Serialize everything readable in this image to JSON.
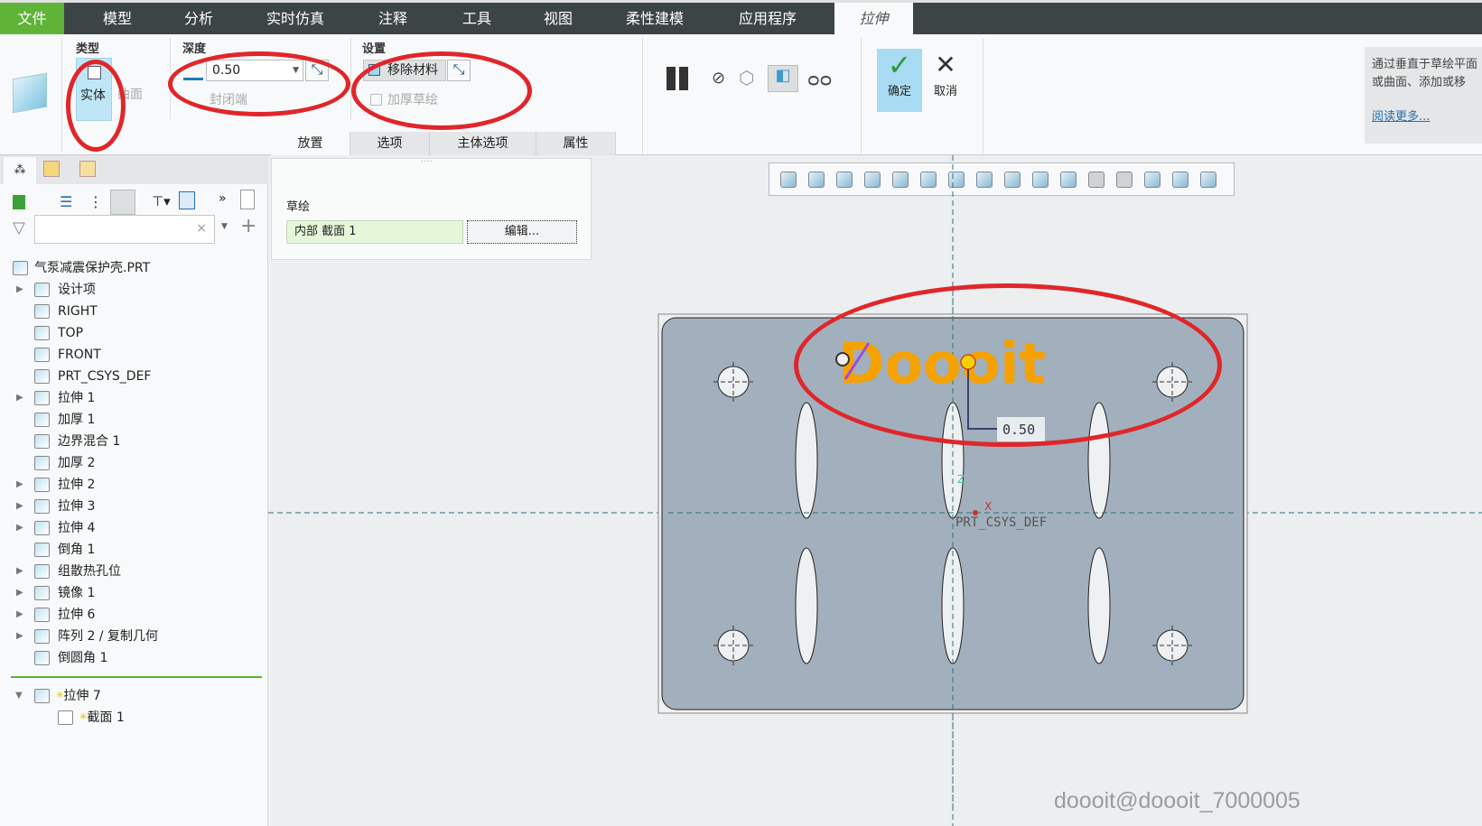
{
  "menu": {
    "tabs": [
      "文件",
      "模型",
      "分析",
      "实时仿真",
      "注释",
      "工具",
      "视图",
      "柔性建模",
      "应用程序",
      "拉伸"
    ]
  },
  "ribbon": {
    "type": {
      "label": "类型",
      "solid": "实体",
      "surface": "曲面"
    },
    "depth": {
      "label": "深度",
      "value": "0.50",
      "capped_ends": "封闭端"
    },
    "settings": {
      "label": "设置",
      "remove_material": "移除材料",
      "thicken_sketch": "加厚草绘"
    },
    "ok": "确定",
    "cancel": "取消",
    "tabs": [
      "放置",
      "选项",
      "主体选项",
      "属性"
    ]
  },
  "help": {
    "text": "通过垂直于草绘平面或曲面、添加或移",
    "link": "阅读更多..."
  },
  "sketch_panel": {
    "label": "草绘",
    "section": "内部 截面 1",
    "edit": "编辑..."
  },
  "tree": {
    "search_placeholder": "",
    "root": "气泵减震保护壳.PRT",
    "items": [
      {
        "label": "设计项",
        "expand": true
      },
      {
        "label": "RIGHT",
        "expand": false
      },
      {
        "label": "TOP",
        "expand": false
      },
      {
        "label": "FRONT",
        "expand": false
      },
      {
        "label": "PRT_CSYS_DEF",
        "expand": false
      },
      {
        "label": "拉伸 1",
        "expand": true
      },
      {
        "label": "加厚 1",
        "expand": false
      },
      {
        "label": "边界混合 1",
        "expand": false
      },
      {
        "label": "加厚 2",
        "expand": false
      },
      {
        "label": "拉伸 2",
        "expand": true
      },
      {
        "label": "拉伸 3",
        "expand": true
      },
      {
        "label": "拉伸 4",
        "expand": true
      },
      {
        "label": "倒角 1",
        "expand": false
      },
      {
        "label": "组散热孔位",
        "expand": true
      },
      {
        "label": "镜像 1",
        "expand": true
      },
      {
        "label": "拉伸 6",
        "expand": true
      },
      {
        "label": "阵列 2 / 复制几何",
        "expand": true
      },
      {
        "label": "倒圆角 1",
        "expand": false
      }
    ],
    "active": "拉伸 7",
    "active_child": "截面 1"
  },
  "viewport": {
    "text": "Doooit",
    "dimension": "0.50",
    "csys": "PRT_CSYS_DEF",
    "axis_x": "X",
    "axis_z": "Z",
    "watermark": "doooit@doooit_7000005"
  },
  "colors": {
    "accent_green": "#5fb336",
    "menu_bg": "#3c4446",
    "part": "#a2b0bd",
    "annotation": "#e0262a",
    "text_orange": "#f5a200"
  }
}
